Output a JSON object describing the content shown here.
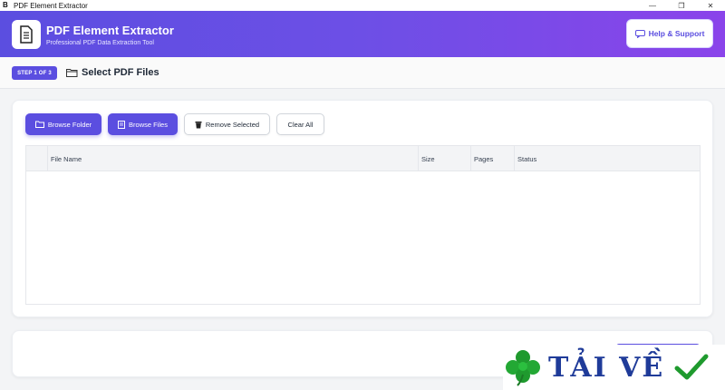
{
  "window": {
    "title": "PDF Element Extractor",
    "app_icon_glyph": "B",
    "controls": [
      "—",
      "❐",
      "✕"
    ]
  },
  "header": {
    "title": "PDF Element Extractor",
    "subtitle": "Professional PDF Data Extraction Tool",
    "help_button": "Help & Support",
    "gradient": [
      "#5b4ee0",
      "#8a44ea"
    ]
  },
  "step": {
    "badge": "STEP 1 OF 3",
    "title": "Select PDF Files",
    "icon": "folder-icon"
  },
  "toolbar": {
    "browse_folder": "Browse Folder",
    "browse_files": "Browse Files",
    "remove_selected": "Remove Selected",
    "clear_all": "Clear All"
  },
  "table": {
    "columns": [
      "",
      "File Name",
      "Size",
      "Pages",
      "Status"
    ],
    "rows": []
  },
  "watermark": {
    "text": "TẢI VỀ",
    "icons": [
      "clover-icon",
      "check-icon"
    ]
  },
  "colors": {
    "accent": "#5b4ee0",
    "background": "#f3f4f6"
  }
}
